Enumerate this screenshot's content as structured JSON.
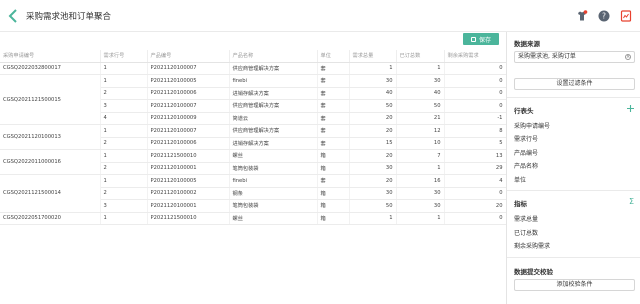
{
  "header": {
    "title": "采购需求池和订单聚合"
  },
  "toolbar": {
    "save_label": "保存"
  },
  "table": {
    "columns": [
      "采购申请编号",
      "需求行号",
      "产品编号",
      "产品名称",
      "单位",
      "需求总量",
      "已订总数",
      "剩余采购需求"
    ],
    "groups": [
      {
        "request_no": "CGSQ2022032800017",
        "rows": [
          [
            "1",
            "P2021120100007",
            "供应商管理解决方案",
            "套",
            "1",
            "1",
            "0"
          ]
        ]
      },
      {
        "request_no": "CGSQ2021121500015",
        "rows": [
          [
            "1",
            "P2021120100005",
            "finebi",
            "套",
            "30",
            "30",
            "0"
          ],
          [
            "2",
            "P2021120100006",
            "进销存解决方案",
            "套",
            "40",
            "40",
            "0"
          ],
          [
            "3",
            "P2021120100007",
            "供应商管理解决方案",
            "套",
            "50",
            "50",
            "0"
          ],
          [
            "4",
            "P2021120100009",
            "简道云",
            "套",
            "20",
            "21",
            "-1"
          ]
        ]
      },
      {
        "request_no": "CGSQ2021120100013",
        "rows": [
          [
            "1",
            "P2021120100007",
            "供应商管理解决方案",
            "套",
            "20",
            "12",
            "8"
          ],
          [
            "2",
            "P2021120100006",
            "进销存解决方案",
            "套",
            "15",
            "10",
            "5"
          ]
        ]
      },
      {
        "request_no": "CGSQ2022011000016",
        "rows": [
          [
            "1",
            "P2021121500010",
            "螺丝",
            "箱",
            "20",
            "7",
            "13"
          ],
          [
            "2",
            "P2021120100001",
            "笔筒包装袋",
            "箱",
            "30",
            "1",
            "29"
          ]
        ]
      },
      {
        "request_no": "CGSQ2021121500014",
        "rows": [
          [
            "1",
            "P2021120100005",
            "finebi",
            "套",
            "20",
            "16",
            "4"
          ],
          [
            "2",
            "P2021120100002",
            "钢条",
            "箱",
            "30",
            "30",
            "0"
          ],
          [
            "3",
            "P2021120100001",
            "笔筒包装袋",
            "箱",
            "50",
            "30",
            "20"
          ]
        ]
      },
      {
        "request_no": "CGSQ2022051700020",
        "rows": [
          [
            "1",
            "P2021121500010",
            "螺丝",
            "箱",
            "1",
            "1",
            "0"
          ]
        ]
      }
    ]
  },
  "panel": {
    "data_source": {
      "title": "数据来源",
      "value": "采购需求池, 采购订单",
      "filter_button": "设置过滤条件"
    },
    "row_headers": {
      "title": "行表头",
      "fields": [
        "采购申请编号",
        "需求行号",
        "产品编号",
        "产品名称",
        "单位"
      ]
    },
    "metrics": {
      "title": "指标",
      "fields": [
        "需求总量",
        "已订总数",
        "剩余采购需求"
      ]
    },
    "validation": {
      "title": "数据提交校验",
      "button": "添加校验条件"
    }
  },
  "colors": {
    "accent": "#4bb59b",
    "warning": "#e8412f",
    "help": "#5a6472"
  },
  "icons": [
    "back-chevron-icon",
    "shirt-alert-icon",
    "help-icon",
    "report-icon",
    "save-icon",
    "plus-icon",
    "sigma-icon",
    "clear-icon"
  ]
}
